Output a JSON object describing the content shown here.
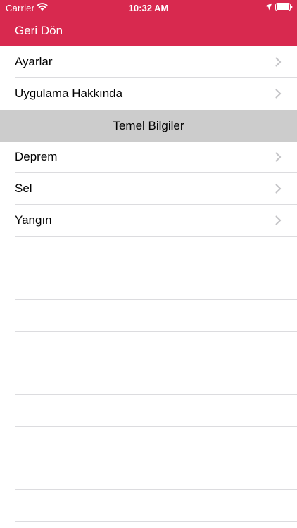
{
  "colors": {
    "accent": "#d8294f",
    "section_header_bg": "#cccccc",
    "separator": "#dcdcdf",
    "chevron": "#c4c4c7"
  },
  "status_bar": {
    "carrier": "Carrier",
    "time": "10:32 AM"
  },
  "nav": {
    "back_label": "Geri Dön"
  },
  "menu": {
    "items": [
      {
        "label": "Ayarlar",
        "icon": "chevron-right-icon"
      },
      {
        "label": "Uygulama Hakkında",
        "icon": "chevron-right-icon"
      }
    ]
  },
  "section": {
    "title": "Temel Bilgiler",
    "items": [
      {
        "label": "Deprem",
        "icon": "chevron-right-icon"
      },
      {
        "label": "Sel",
        "icon": "chevron-right-icon"
      },
      {
        "label": "Yangın",
        "icon": "chevron-right-icon"
      }
    ]
  }
}
